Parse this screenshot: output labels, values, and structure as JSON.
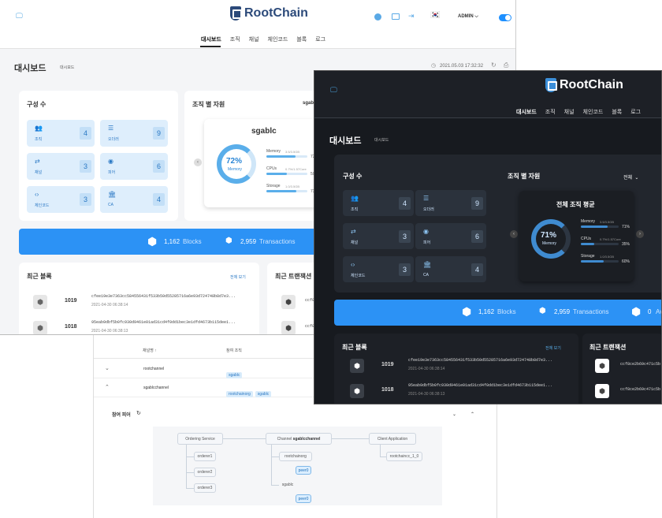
{
  "brand": {
    "name": "RootChain"
  },
  "nav": [
    "대시보드",
    "조직",
    "채널",
    "체인코드",
    "블록",
    "로그"
  ],
  "header": {
    "admin_label": "ADMIN",
    "flag": "🇰🇷"
  },
  "page": {
    "title": "대시보드",
    "breadcrumb": "대시보드",
    "timestamp": "2021.05.03 17:32:32"
  },
  "composition": {
    "title": "구성 수",
    "tiles": [
      {
        "label": "조직",
        "value": "4",
        "icon": "users-icon"
      },
      {
        "label": "오더러",
        "value": "9",
        "icon": "list-icon"
      },
      {
        "label": "채널",
        "value": "3",
        "icon": "swap-icon"
      },
      {
        "label": "피어",
        "value": "6",
        "icon": "peer-icon"
      },
      {
        "label": "체인코드",
        "value": "3",
        "icon": "code-icon"
      },
      {
        "label": "CA",
        "value": "4",
        "icon": "bank-icon"
      }
    ]
  },
  "org_resources": {
    "title": "조직 별 자원",
    "light": {
      "selected": "sgablc",
      "org_name": "sgablc",
      "gauge_value": "72%",
      "gauge_label": "Memory",
      "bars": [
        {
          "label": "Memory",
          "sub": "3.5/3.5GB",
          "pct": "72%",
          "fraction": 0.72
        },
        {
          "label": "CPUs",
          "sub": "0.7%/1.57Core",
          "pct": "50%",
          "fraction": 0.5
        },
        {
          "label": "Storage",
          "sub": "1.0/3.5GB",
          "pct": "73%",
          "fraction": 0.73
        }
      ]
    },
    "dark": {
      "selected": "전체",
      "org_name": "전체 조직 평균",
      "gauge_value": "71%",
      "gauge_label": "Memory",
      "bars": [
        {
          "label": "Memory",
          "sub": "3.5/3.5GB",
          "pct": "71%",
          "fraction": 0.71
        },
        {
          "label": "CPUs",
          "sub": "0.7%/1.57Core",
          "pct": "35%",
          "fraction": 0.35
        },
        {
          "label": "Storage",
          "sub": "1.0/3.5GB",
          "pct": "60%",
          "fraction": 0.6
        }
      ]
    }
  },
  "stats": {
    "blocks_count": "1,162",
    "blocks_label": "Blocks",
    "tx_count": "2,959",
    "tx_label": "Transactions",
    "third_count": "0",
    "third_label": "Av"
  },
  "recent_blocks": {
    "title": "최근 블록",
    "view_all": "전체 보기",
    "rows": [
      {
        "number": "1019",
        "hash": "cfee19e3e7363cc584556431f533b50d55285716a6e93d724748b8d7e3...",
        "time": "2021-04-30 06:38:14"
      },
      {
        "number": "1018",
        "hash": "95eab9dbf5b0fc930d9461e01ad31cd4f0dd1bec3e1dfd4673b115dee1...",
        "time": "2021-04-30 06:38:13"
      }
    ]
  },
  "recent_tx": {
    "title": "최근 트랜잭션",
    "rows": [
      {
        "hash": "ccf8ce2b69c471c5b"
      },
      {
        "hash": "ccf8ce2b69c471c5b"
      }
    ]
  },
  "channels": {
    "col_name": "채널명",
    "col_orgs": "참여 조직",
    "rows": [
      {
        "name": "rootchannel",
        "orgs": [
          "sgablc"
        ]
      },
      {
        "name": "sgablcchannel",
        "orgs": [
          "rootchainorg",
          "sgablc"
        ]
      }
    ],
    "members_label": "참여 피어",
    "diagram": {
      "ordering": "Ordering Service",
      "channel_prefix": "Channel",
      "channel_name": "sgablcchannel",
      "client": "Client Application",
      "orderers": [
        "orderer1",
        "orderer2",
        "orderer3"
      ],
      "orgs": [
        {
          "name": "rootchainorg",
          "peer": "peer0"
        },
        {
          "name": "sgablc",
          "peer": "peer0"
        }
      ],
      "client_app": "rootchaincc_1_0"
    }
  },
  "colors": {
    "accent": "#2c92f5",
    "dark_bg": "#171a1f",
    "dark_card": "#22262d",
    "tile_light": "#deeefc",
    "tile_dark": "#2b323c"
  }
}
